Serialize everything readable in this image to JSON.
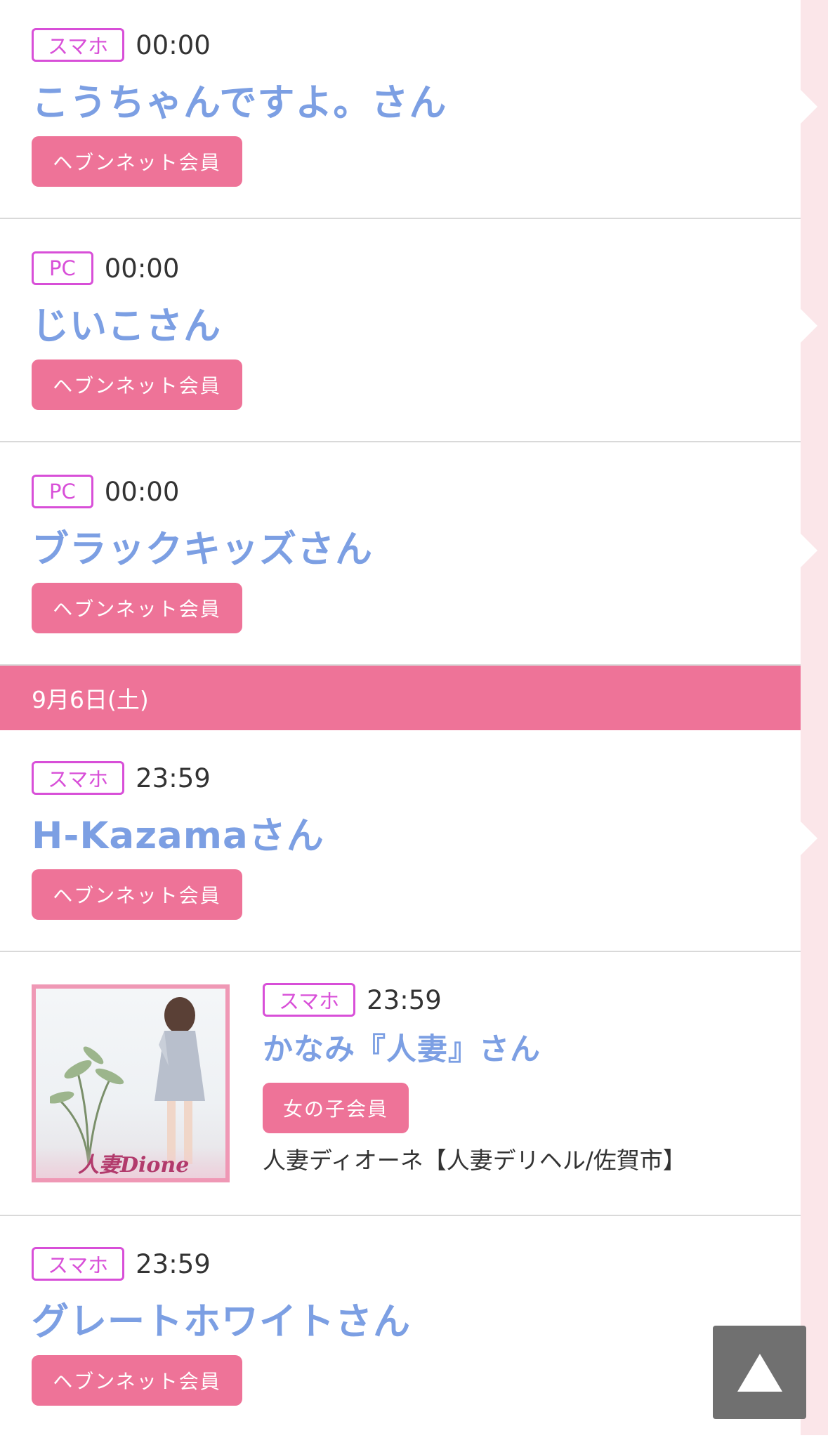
{
  "entries_before": [
    {
      "device": "スマホ",
      "time": "00:00",
      "name": "こうちゃんですよ。さん",
      "member": "ヘブンネット会員"
    },
    {
      "device": "PC",
      "time": "00:00",
      "name": "じいこさん",
      "member": "ヘブンネット会員"
    },
    {
      "device": "PC",
      "time": "00:00",
      "name": "ブラックキッズさん",
      "member": "ヘブンネット会員"
    }
  ],
  "date_header": "9月6日(土)",
  "entries_after": [
    {
      "device": "スマホ",
      "time": "23:59",
      "name": "H-Kazamaさん",
      "member": "ヘブンネット会員"
    },
    {
      "device": "スマホ",
      "time": "23:59",
      "name": "かなみ『人妻』さん",
      "member": "女の子会員",
      "shop": "人妻ディオーネ【人妻デリヘル/佐賀市】",
      "thumb_logo": "人妻Dione"
    },
    {
      "device": "スマホ",
      "time": "23:59",
      "name": "グレートホワイトさん",
      "member": "ヘブンネット会員"
    }
  ],
  "colors": {
    "accent_pink": "#ee7398",
    "device_magenta": "#d84fd8",
    "name_blue": "#7c9fe3",
    "scroll_button": "#707070"
  },
  "icons": {
    "scroll_top": "triangle-up-icon"
  }
}
